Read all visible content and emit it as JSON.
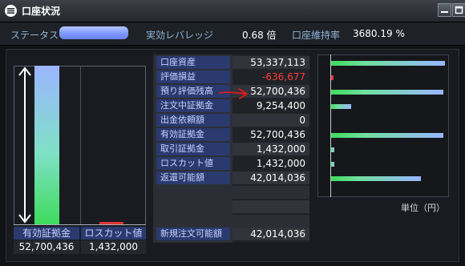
{
  "window": {
    "title": "口座状況"
  },
  "status": {
    "status_label": "ステータス",
    "leverage_label": "実効レバレッジ",
    "leverage_value": "0.68 倍",
    "margin_rate_label": "口座維持率",
    "margin_rate_value": "3680.19 %"
  },
  "left_chart": {
    "headers": [
      "有効証拠金",
      "ロスカット値"
    ],
    "values": [
      "52,700,436",
      "1,432,000"
    ],
    "effective_margin": 52700436,
    "loss_cut": 1432000
  },
  "table": {
    "rows": [
      {
        "label": "口座資産",
        "value": "53,337,113"
      },
      {
        "label": "評価損益",
        "value": "-636,677"
      },
      {
        "label": "預り評価残高",
        "value": "52,700,436"
      },
      {
        "label": "注文中証拠金",
        "value": "9,254,400"
      },
      {
        "label": "出金依頼額",
        "value": "0"
      },
      {
        "label": "有効証拠金",
        "value": "52,700,436"
      },
      {
        "label": "取引証拠金",
        "value": "1,432,000"
      },
      {
        "label": "ロスカット値",
        "value": "1,432,000"
      },
      {
        "label": "返還可能額",
        "value": "42,014,036"
      }
    ],
    "footer": {
      "label": "新規注文可能額",
      "value": "42,014,036"
    }
  },
  "right_chart": {
    "unit_label": "単位（円）",
    "values": [
      53337113,
      -636677,
      52700436,
      9254400,
      0,
      52700436,
      1432000,
      1432000,
      42014036
    ]
  }
}
